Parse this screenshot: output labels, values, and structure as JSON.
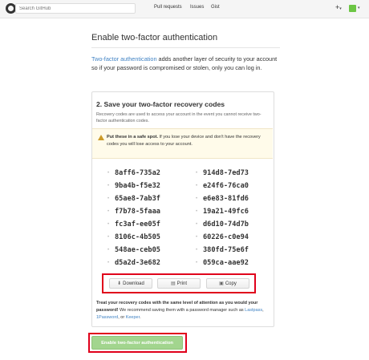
{
  "header": {
    "search_placeholder": "Search GitHub",
    "nav": {
      "pull_requests": "Pull requests",
      "issues": "Issues",
      "gist": "Gist"
    },
    "new_button": "+",
    "caret": "▾"
  },
  "page": {
    "title": "Enable two-factor authentication",
    "intro_link": "Two-factor authentication",
    "intro_text": " adds another layer of security to your account so if your password is compromised or stolen, only you can log in."
  },
  "recovery": {
    "step_title": "2. Save your two-factor recovery codes",
    "description": "Recovery codes are used to access your account in the event you cannot receive two-factor authentication codes.",
    "warning_bold": "Put these in a safe spot.",
    "warning_text": " If you lose your device and don't have the recovery codes you will lose access to your account.",
    "codes_left": [
      "8aff6-735a2",
      "9ba4b-f5e32",
      "65ae8-7ab3f",
      "f7b78-5faaa",
      "fc3af-ee05f",
      "8106c-4b505",
      "548ae-ceb05",
      "d5a2d-3e682"
    ],
    "codes_right": [
      "914d8-7ed73",
      "e24f6-76ca0",
      "e6e83-81fd6",
      "19a21-49fc6",
      "d6d10-74d7b",
      "60226-c0e94",
      "380fd-75e6f",
      "059ca-aae92"
    ],
    "buttons": {
      "download": "Download",
      "print": "Print",
      "copy": "Copy"
    },
    "note_bold": "Treat your recovery codes with the same level of attention as you would your password!",
    "note_text": " We recommend saving them with a password manager such as ",
    "note_link1": "Lastpass",
    "note_sep1": ", ",
    "note_link2": "1Password",
    "note_sep2": ", or ",
    "note_link3": "Keeper",
    "note_end": "."
  },
  "enable_button": "Enable two-factor authentication",
  "colors": {
    "link": "#4183c4",
    "highlight": "#e0001b",
    "enable_button": "#a2d58e",
    "warning_bg": "#fffbea"
  }
}
